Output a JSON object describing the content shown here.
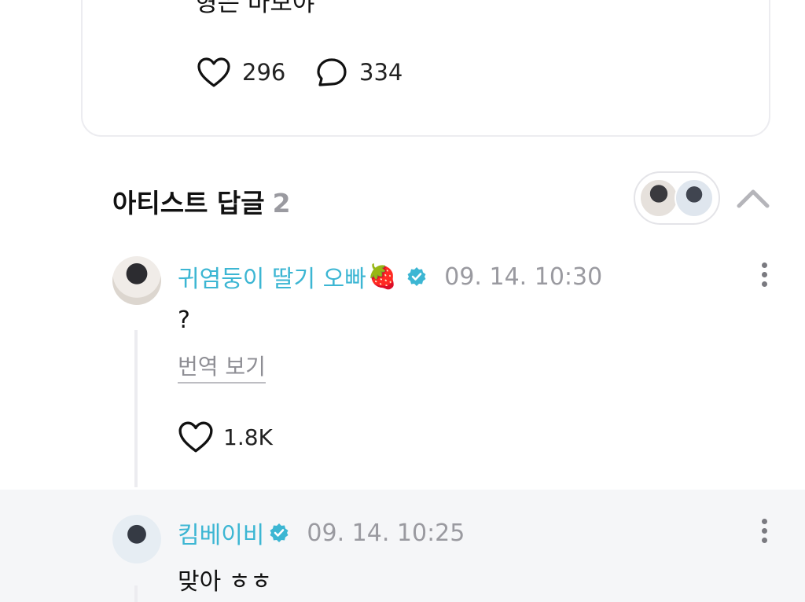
{
  "post": {
    "text": "형은 바보야",
    "likes": "296",
    "comments": "334"
  },
  "artist_replies": {
    "title": "아티스트 답글",
    "count": "2"
  },
  "replies": [
    {
      "name": "귀염둥이 딸기 오빠",
      "emoji": "🍓",
      "verified": true,
      "time": "09. 14. 10:30",
      "body": "?",
      "translate": "번역 보기",
      "likes": "1.8K"
    },
    {
      "name": "킴베이비",
      "verified": true,
      "time": "09. 14. 10:25",
      "body": "맞아 ㅎㅎ"
    }
  ],
  "colors": {
    "accent": "#3cb6d3",
    "muted": "#9a9aa0",
    "reply_bg": "#f5f6f8"
  },
  "icons": {
    "like": "heart-icon",
    "comment": "speech-bubble-icon",
    "verified": "verified-badge-icon",
    "more": "more-vertical-icon",
    "collapse": "chevron-up-icon"
  }
}
